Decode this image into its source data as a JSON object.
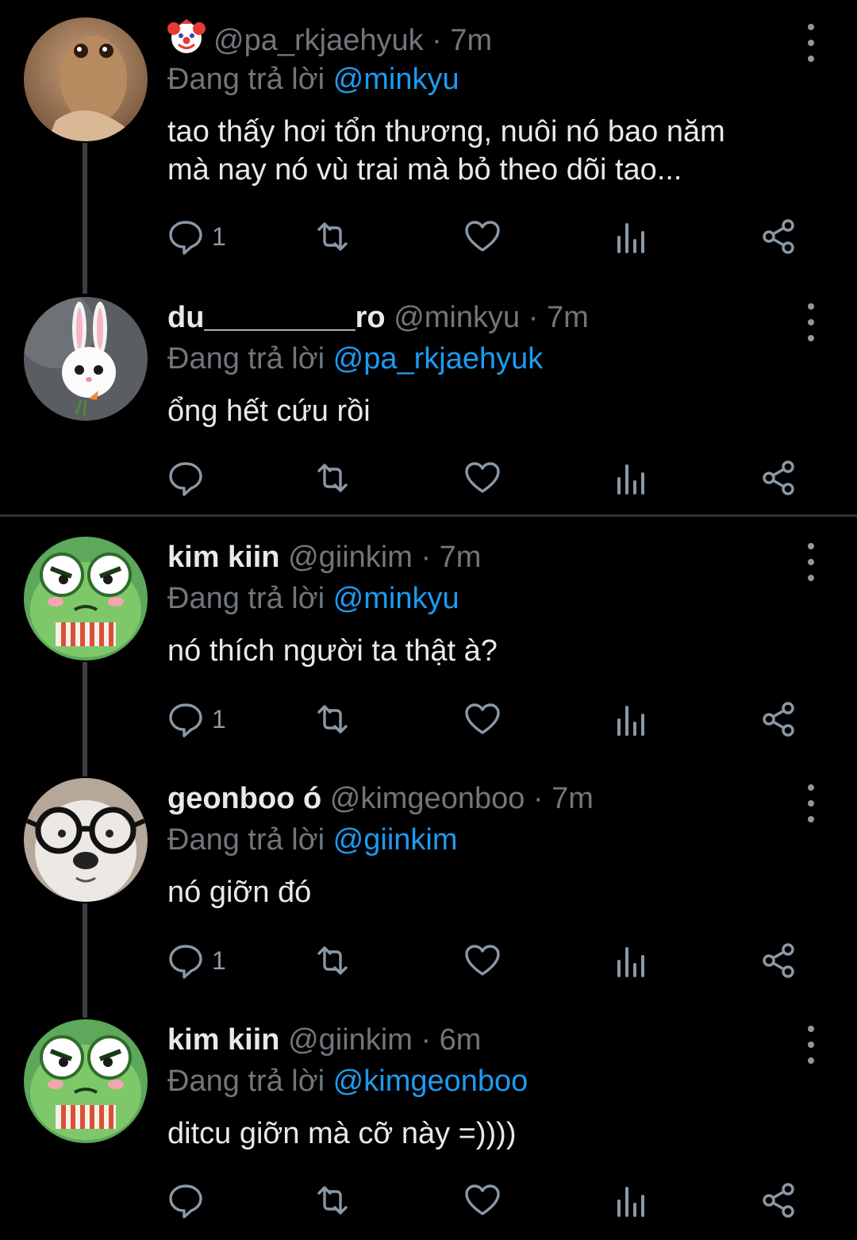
{
  "tweets": [
    {
      "name": "",
      "name_emoji": "clown-face",
      "handle": "@pa_rkjaehyuk",
      "time": "7m",
      "reply_prefix": "Đang trả lời",
      "reply_to": "@minkyu",
      "text_lines": [
        "tao thấy hơi tổn thương, nuôi nó bao năm",
        "mà nay nó vù trai mà bỏ theo dõi tao..."
      ],
      "reply_count": "1",
      "avatar": "fish-avatar"
    },
    {
      "name": "du_________ro",
      "handle": "@minkyu",
      "time": "7m",
      "reply_prefix": "Đang trả lời",
      "reply_to": "@pa_rkjaehyuk",
      "text_lines": [
        "ổng hết cứu rồi"
      ],
      "reply_count": "",
      "avatar": "bunny-avatar"
    },
    {
      "name": "kim kiin",
      "handle": "@giinkim",
      "time": "7m",
      "reply_prefix": "Đang trả lời",
      "reply_to": "@minkyu",
      "text_lines": [
        "nó thích người ta thật à?"
      ],
      "reply_count": "1",
      "avatar": "frog-avatar"
    },
    {
      "name": "geonboo ó",
      "handle": "@kimgeonboo",
      "time": "7m",
      "reply_prefix": "Đang trả lời",
      "reply_to": "@giinkim",
      "text_lines": [
        "nó giỡn đó"
      ],
      "reply_count": "1",
      "avatar": "bear-glasses-avatar"
    },
    {
      "name": "kim kiin",
      "handle": "@giinkim",
      "time": "6m",
      "reply_prefix": "Đang trả lời",
      "reply_to": "@kimgeonboo",
      "text_lines": [
        "ditcu giỡn mà cỡ này =))))"
      ],
      "reply_count": "",
      "avatar": "frog-avatar"
    }
  ],
  "colors": {
    "background": "#000000",
    "text": "#e7e9ea",
    "muted": "#71767b",
    "accent": "#1d9bf0",
    "icon": "#8b98a5"
  }
}
